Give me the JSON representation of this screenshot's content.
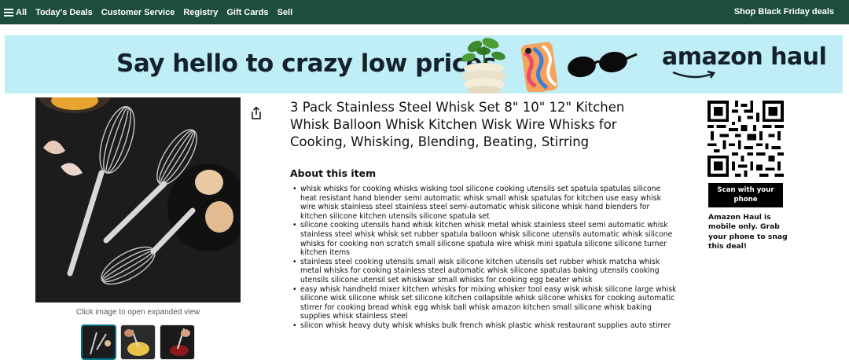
{
  "nav": {
    "all_label": "All",
    "items": [
      "Today's Deals",
      "Customer Service",
      "Registry",
      "Gift Cards",
      "Sell"
    ],
    "right_label": "Shop Black Friday deals"
  },
  "banner": {
    "headline": "Say hello to crazy low prices",
    "brand": "amazon haul"
  },
  "gallery": {
    "caption": "Click image to open expanded view",
    "thumbnail_count": 3,
    "selected_thumbnail": 1
  },
  "product": {
    "title": "3 Pack Stainless Steel Whisk Set 8\" 10\" 12\" Kitchen Whisk Balloon Whisk Kitchen Wisk Wire Whisks for Cooking, Whisking, Blending, Beating, Stirring",
    "about_heading": "About this item",
    "bullets": [
      "whisk whisks for cooking whisks wisking tool silicone cooking utensils set spatula spatulas silicone heat resistant hand blender semi automatic whisk small whisk spatulas for kitchen use easy whisk wire whisk stainless steel stainless steel semi-automatic whisk silicone whisk hand blenders for kitchen silicone kitchen utensils silicone spatula set",
      "silicone cooking utensils hand whisk kitchen whisk metal whisk stainless steel semi automatic whisk stainless steel whisk whisk set rubber spatula balloon whisk silicone utensils automatic whisk silicone whisks for cooking non scratch small silicone spatula wire whisk mini spatula silicone silicone turner kitchen items",
      "stainless steel cooking utensils small wisk silicone kitchen utensils set rubber whisk matcha whisk metal whisks for cooking stainless steel automatic whisk silicone spatulas baking utensils cooking utensils silicone utensil set whiskwar small whisks for cooking egg beater whisk",
      "easy whisk handheld mixer kitchen whisks for mixing whisker tool easy wisk whisk silicone large whisk silicone wisk silicone whisk set silicone kitchen collapsible whisk silicone whisks for cooking automatic stirrer for cooking bread whisk egg whisk ball whisk amazon kitchen small silicone whisk baking supplies whisk stainless steel",
      "silicon whisk heavy duty whisk whisks bulk french whisk plastic whisk restaurant supplies auto stirrer"
    ]
  },
  "haul_panel": {
    "scan_button": "Scan with your phone",
    "note": "Amazon Haul is mobile only. Grab your phone to snag this deal!"
  },
  "colors": {
    "nav_bg": "#1d4d3d",
    "banner_bg": "#bfeef7",
    "thumb_selected": "#007185"
  }
}
